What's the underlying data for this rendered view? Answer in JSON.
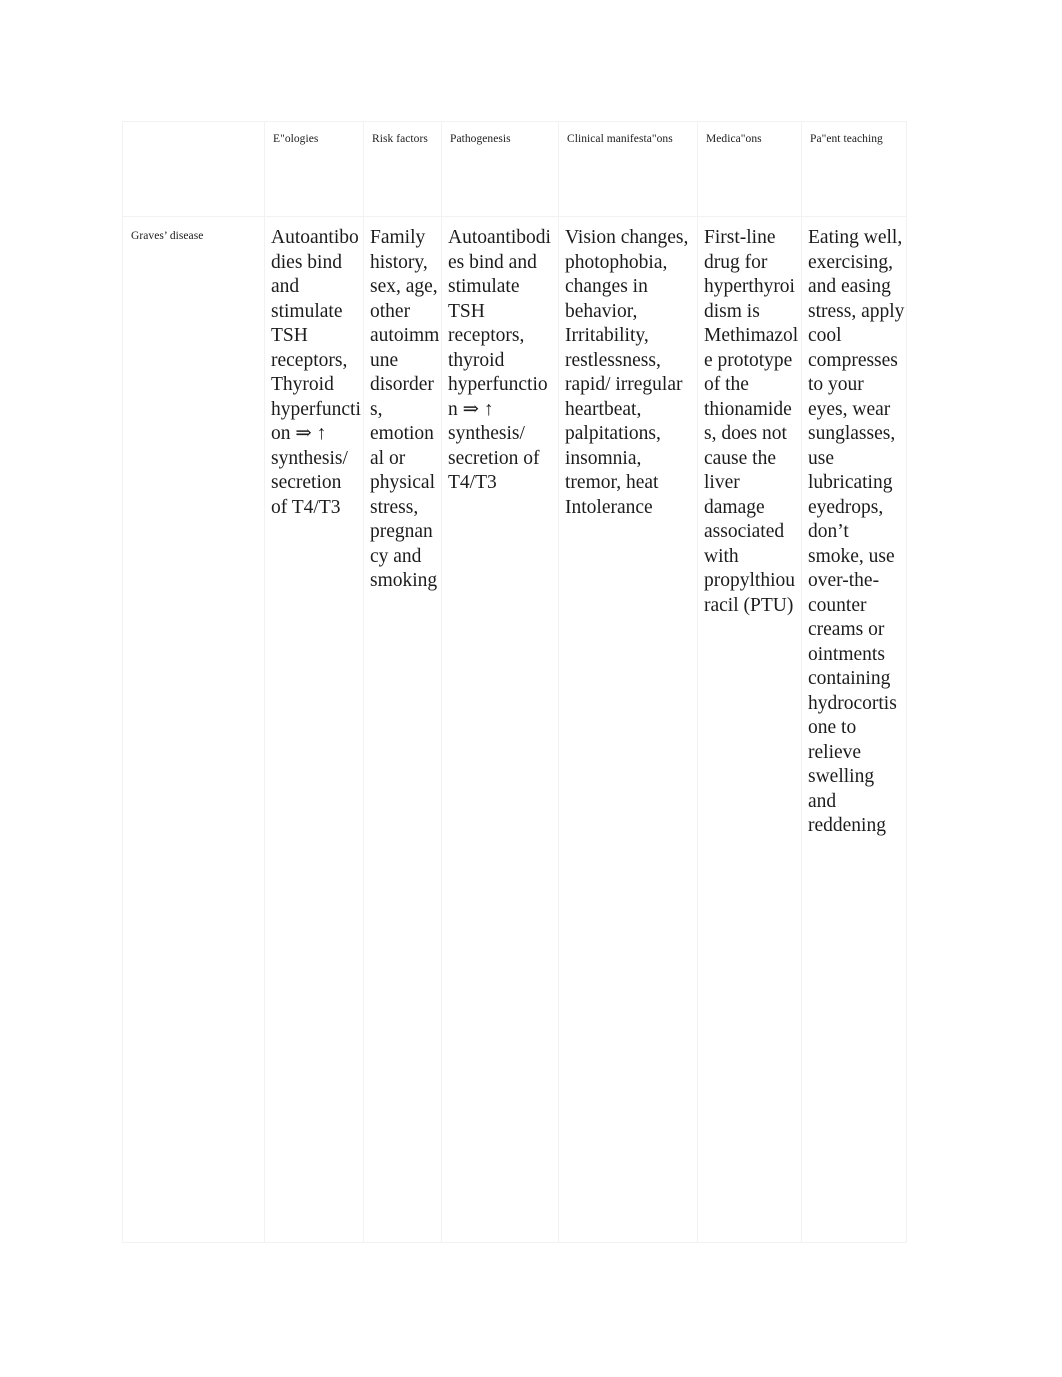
{
  "document": {
    "type": "table",
    "background_color": "#ffffff",
    "border_color": "#f2f2f2",
    "text_color": "#1c1c1c"
  },
  "table": {
    "headers": {
      "corner": "",
      "etiologies": "E\"ologies",
      "risk_factors": "Risk factors",
      "pathogenesis": "Pathogenesis",
      "clinical_manifestations": "Clinical manifesta\"ons",
      "medications": "Medica\"ons",
      "patient_teaching": "Pa\"ent teaching"
    },
    "rows": [
      {
        "label": "Graves’ disease",
        "etiologies": "Autoantibodies bind and stimulate TSH receptors, Thyroid hyperfunction ⇒ ↑ synthesis/ secretion of T4/T3",
        "risk_factors": "Family history, sex, age, other autoimmune disorders, emotional or physical stress, pregnancy and smoking",
        "pathogenesis": "Autoantibodies bind and stimulate TSH receptors, thyroid hyperfunction ⇒ ↑ synthesis/ secretion of T4/T3",
        "clinical_manifestations": "Vision changes, photophobia, changes in behavior, Irritability, restlessness, rapid/ irregular heartbeat, palpitations, insomnia, tremor, heat Intolerance",
        "medications": "First-line drug for hyperthyroidism is Methimazole prototype of the thionamides, does not cause the liver damage associated with propylthiouracil (PTU)",
        "patient_teaching": "Eating well, exercising, and easing stress, apply cool compresses to your eyes, wear sunglasses, use lubricating eyedrops, don’t smoke, use over-the-counter creams or ointments containing hydrocortisone to relieve swelling and reddening"
      }
    ]
  }
}
